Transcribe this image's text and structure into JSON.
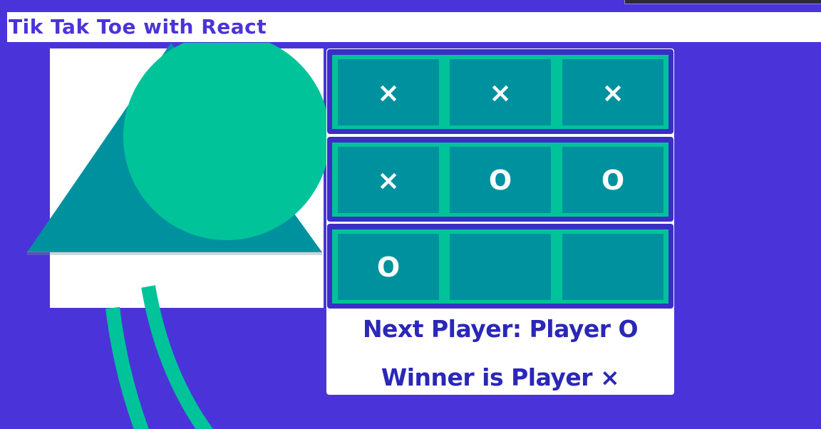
{
  "header": {
    "title": "Tik Tak Toe with React"
  },
  "board": {
    "rows": [
      [
        "×",
        "×",
        "×"
      ],
      [
        "×",
        "O",
        "O"
      ],
      [
        "O",
        "",
        ""
      ]
    ]
  },
  "status": {
    "next_player": "Next Player: Player O",
    "winner": "Winner is Player ×"
  },
  "colors": {
    "background": "#4a34d9",
    "cell": "#00919f",
    "accent_green": "#00c39a",
    "row_border": "#3a2ec7",
    "title_text": "#4a34d9",
    "status_text": "#2b27b8"
  },
  "icons": {
    "x_mark": "cross-icon",
    "o_mark": "circle-icon"
  }
}
